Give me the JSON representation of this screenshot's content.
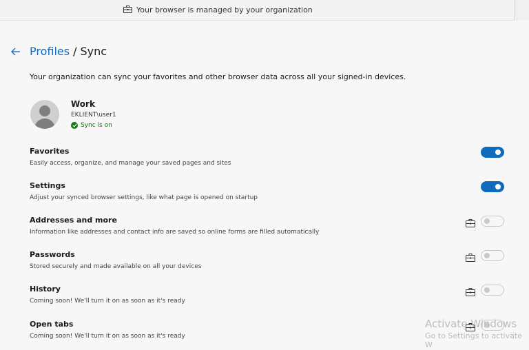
{
  "managed_bar": {
    "text": "Your browser is managed by your organization",
    "icon": "briefcase-icon"
  },
  "header": {
    "back_icon": "arrow-left-icon",
    "breadcrumb_parent": "Profiles",
    "breadcrumb_separator": "/",
    "breadcrumb_current": "Sync"
  },
  "description": "Your organization can sync your favorites and other browser data across all your signed-in devices.",
  "profile": {
    "name": "Work",
    "account": "EKLIENT\\user1",
    "sync_status": "Sync is on"
  },
  "settings": [
    {
      "title": "Favorites",
      "description": "Easily access, organize, and manage your saved pages and sites",
      "enabled": true,
      "managed": false
    },
    {
      "title": "Settings",
      "description": "Adjust your synced browser settings, like what page is opened on startup",
      "enabled": true,
      "managed": false
    },
    {
      "title": "Addresses and more",
      "description": "Information like addresses and contact info are saved so online forms are filled automatically",
      "enabled": false,
      "managed": true
    },
    {
      "title": "Passwords",
      "description": "Stored securely and made available on all your devices",
      "enabled": false,
      "managed": true
    },
    {
      "title": "History",
      "description": "Coming soon! We'll turn it on as soon as it's ready",
      "enabled": false,
      "managed": true
    },
    {
      "title": "Open tabs",
      "description": "Coming soon! We'll turn it on as soon as it's ready",
      "enabled": false,
      "managed": true
    }
  ],
  "watermark": {
    "line1": "Activate Windows",
    "line2": "Go to Settings to activate W"
  },
  "colors": {
    "accent": "#0f6cbd",
    "sync_ok": "#107c10"
  }
}
